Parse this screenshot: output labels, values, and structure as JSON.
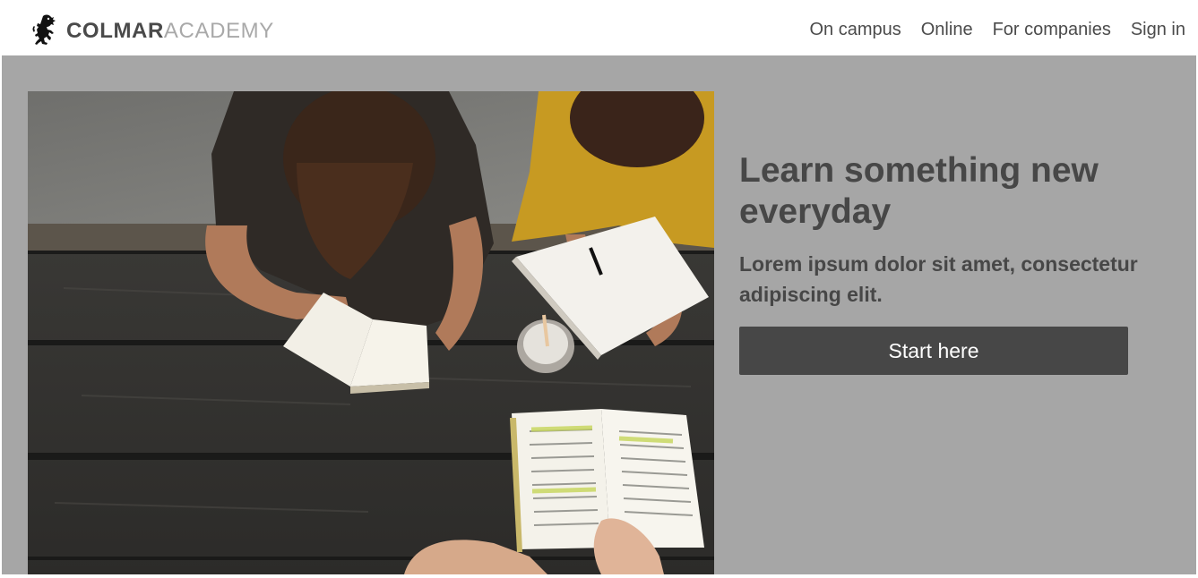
{
  "brand": {
    "name_strong": "COLMAR",
    "name_light": "ACADEMY",
    "logo_icon": "rampant-lion-icon"
  },
  "nav": {
    "items": [
      {
        "label": "On campus"
      },
      {
        "label": "Online"
      },
      {
        "label": "For companies"
      },
      {
        "label": "Sign in"
      }
    ]
  },
  "hero": {
    "image_alt": "Students reading and writing at a wooden table",
    "headline": "Learn something new everyday",
    "subhead": "Lorem ipsum dolor sit amet, consectetur adipiscing elit.",
    "cta_label": "Start here"
  },
  "colors": {
    "hero_background": "#a6a6a6",
    "text_dark": "#474747",
    "brand_light": "#a9a9a9",
    "button_background": "#474747",
    "button_text": "#ffffff"
  }
}
